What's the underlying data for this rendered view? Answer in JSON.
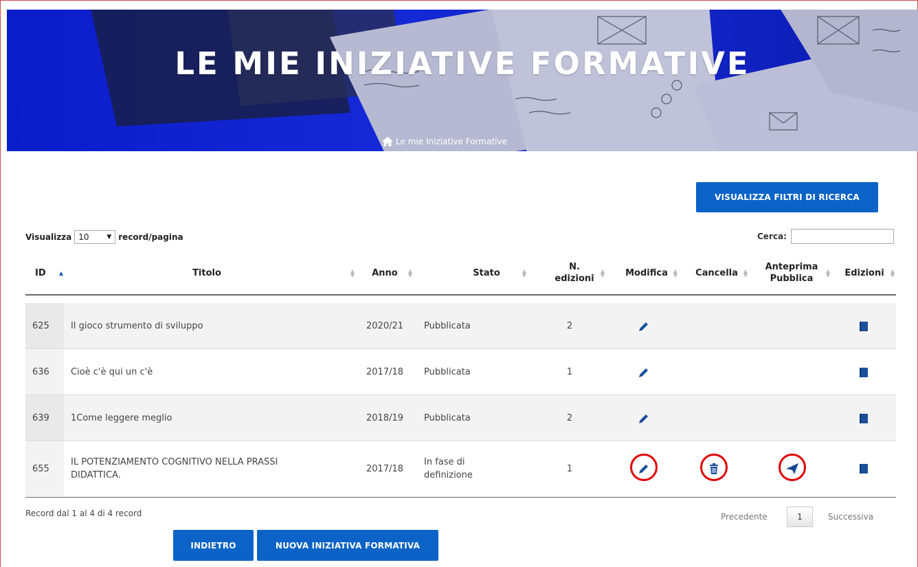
{
  "hero": {
    "title": "LE MIE INIZIATIVE FORMATIVE",
    "breadcrumb_separator": "/",
    "breadcrumb_current": "Le mie Iniziative Formative"
  },
  "toolbar": {
    "filters_label": "VISUALIZZA FILTRI DI RICERCA"
  },
  "length": {
    "prefix": "Visualizza",
    "selected": "10",
    "suffix": "record/pagina"
  },
  "search": {
    "label": "Cerca:",
    "value": ""
  },
  "table": {
    "headers": {
      "id": "ID",
      "titolo": "Titolo",
      "anno": "Anno",
      "stato": "Stato",
      "n_edizioni": "N. edizioni",
      "modifica": "Modifica",
      "cancella": "Cancella",
      "anteprima": "Anteprima Pubblica",
      "edizioni": "Edizioni"
    },
    "rows": [
      {
        "id": "625",
        "titolo": "Il gioco strumento di sviluppo",
        "anno": "2020/21",
        "stato": "Pubblicata",
        "n_edizioni": "2"
      },
      {
        "id": "636",
        "titolo": "Cioè c'è qui un c'è",
        "anno": "2017/18",
        "stato": "Pubblicata",
        "n_edizioni": "1"
      },
      {
        "id": "639",
        "titolo": "1Come leggere meglio",
        "anno": "2018/19",
        "stato": "Pubblicata",
        "n_edizioni": "2"
      },
      {
        "id": "655",
        "titolo": "IL POTENZIAMENTO COGNITIVO NELLA PRASSI DIDATTICA.",
        "anno": "2017/18",
        "stato": "In fase di definizione",
        "n_edizioni": "1"
      }
    ]
  },
  "footer": {
    "info": "Record dal 1 al 4 di 4 record",
    "prev": "Precedente",
    "page": "1",
    "next": "Successiva",
    "back_label": "INDIETRO",
    "new_label": "NUOVA INIZIATIVA FORMATIVA"
  },
  "colors": {
    "hero_blue": "#1529d6",
    "primary_button": "#0b63c7",
    "icon_blue": "#1a4f9c",
    "highlight_red": "#e00000"
  },
  "icons": {
    "home": "home-icon",
    "edit": "pencil-icon",
    "delete": "trash-icon",
    "preview": "send-icon",
    "editions": "book-icon"
  }
}
